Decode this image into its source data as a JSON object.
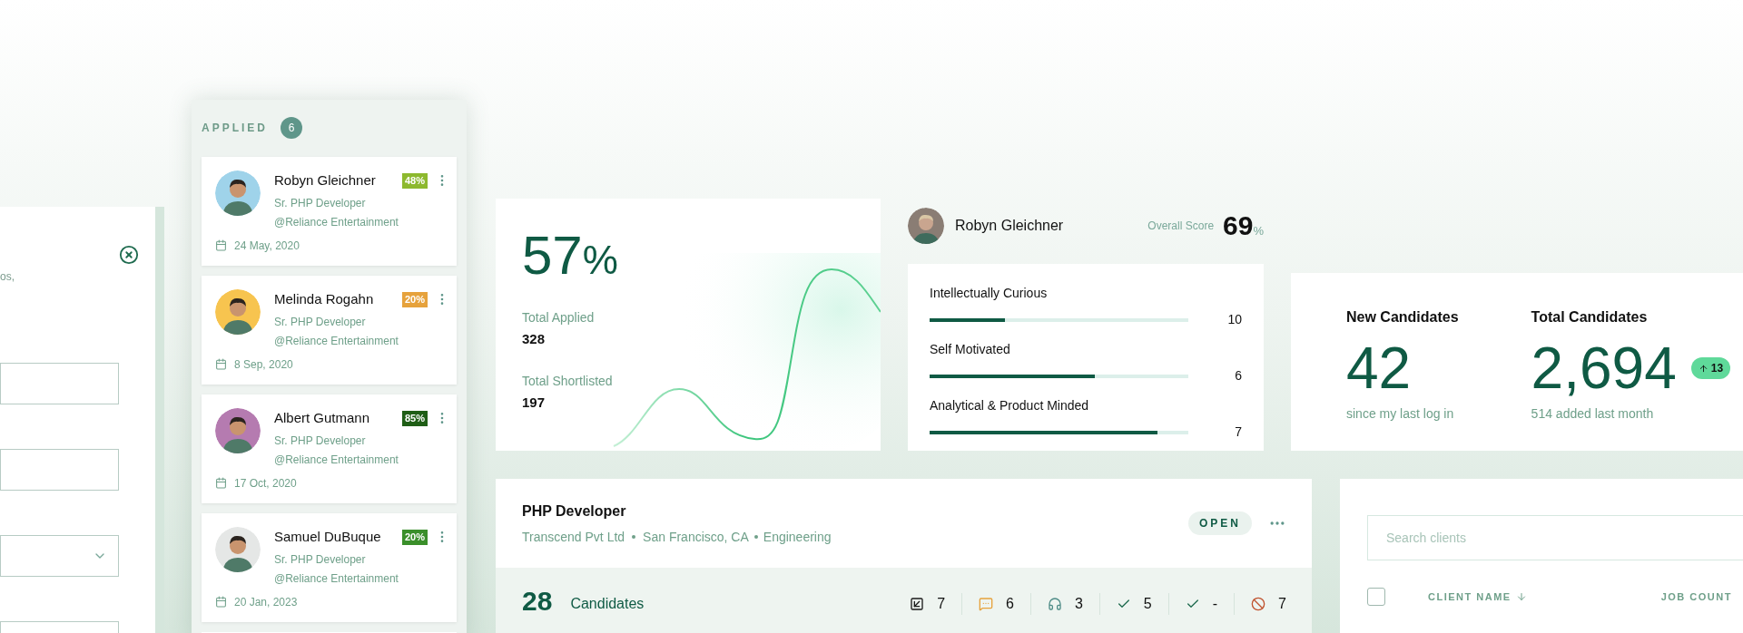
{
  "form_panel": {
    "text_fragment": "os,",
    "fields": [
      {
        "kind": "input"
      },
      {
        "kind": "input"
      },
      {
        "kind": "select"
      },
      {
        "kind": "input"
      }
    ]
  },
  "applied": {
    "title": "APPLIED",
    "count": "6",
    "candidates": [
      {
        "name": "Robyn Gleichner",
        "score": "48%",
        "color": "#8db92e",
        "role": "Sr. PHP Developer",
        "company": "@Reliance Entertainment",
        "date": "24 May, 2020"
      },
      {
        "name": "Melinda Rogahn",
        "score": "20%",
        "color": "#e6a23c",
        "role": "Sr. PHP Developer",
        "company": "@Reliance Entertainment",
        "date": "8 Sep, 2020"
      },
      {
        "name": "Albert Gutmann",
        "score": "85%",
        "color": "#1f5e16",
        "role": "Sr. PHP Developer",
        "company": "@Reliance Entertainment",
        "date": "17 Oct, 2020"
      },
      {
        "name": "Samuel DuBuque",
        "score": "20%",
        "color": "#3a8f2a",
        "role": "Sr. PHP Developer",
        "company": "@Reliance Entertainment",
        "date": "20 Jan, 2023"
      }
    ]
  },
  "conversion": {
    "percent": "57",
    "unit": "%",
    "stats": [
      {
        "label": "Total Applied",
        "value": "328"
      },
      {
        "label": "Total Shortlisted",
        "value": "197"
      }
    ]
  },
  "score_panel": {
    "name": "Robyn Gleichner",
    "score_label": "Overall Score",
    "score": "69",
    "unit": "%",
    "traits": [
      {
        "label": "Intellectually Curious",
        "level": 0.29,
        "value": "10"
      },
      {
        "label": "Self Motivated",
        "level": 0.64,
        "value": "6"
      },
      {
        "label": "Analytical & Product Minded",
        "level": 0.88,
        "value": "7"
      }
    ]
  },
  "candidates_summary": [
    {
      "title": "New Candidates",
      "value": "42",
      "note": "since my last log in"
    },
    {
      "title": "Total Candidates",
      "value": "2,694",
      "note": "514 added last month",
      "badge": "13"
    }
  ],
  "job": {
    "title": "PHP Developer",
    "company": "Transcend Pvt Ltd",
    "location": "San Francisco, CA",
    "department": "Engineering",
    "status": "OPEN",
    "count": "28",
    "count_label": "Candidates",
    "stages": [
      {
        "kind": "forward",
        "value": "7"
      },
      {
        "kind": "chat",
        "value": "6"
      },
      {
        "kind": "headset",
        "value": "3"
      },
      {
        "kind": "check",
        "value": "5"
      },
      {
        "kind": "check",
        "value": "-"
      },
      {
        "kind": "blocked",
        "value": "7"
      }
    ]
  },
  "clients": {
    "search_placeholder": "Search clients",
    "select_all_checked": false,
    "columns": [
      "CLIENT NAME",
      "JOB COUNT"
    ]
  }
}
